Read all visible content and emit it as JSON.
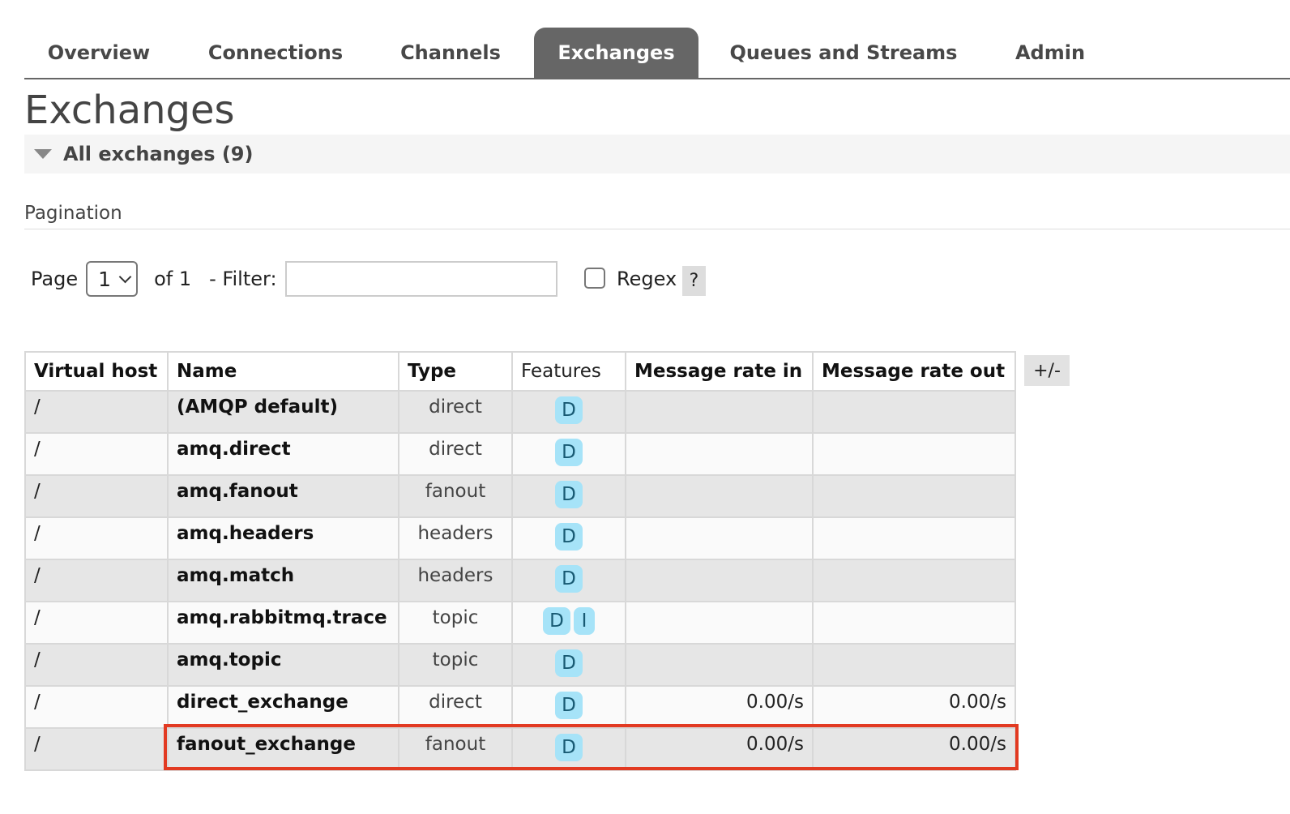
{
  "nav": {
    "tabs": [
      {
        "label": "Overview"
      },
      {
        "label": "Connections"
      },
      {
        "label": "Channels"
      },
      {
        "label": "Exchanges",
        "active": true
      },
      {
        "label": "Queues and Streams"
      },
      {
        "label": "Admin"
      }
    ]
  },
  "page": {
    "title": "Exchanges",
    "section_label": "All exchanges (9)"
  },
  "pagination": {
    "title": "Pagination",
    "page_label": "Page",
    "page_value": "1",
    "of_label": "of 1",
    "filter_label": "- Filter:",
    "filter_value": "",
    "regex_label": "Regex",
    "regex_checked": false,
    "help_label": "?"
  },
  "table": {
    "headers": [
      "Virtual host",
      "Name",
      "Type",
      "Features",
      "Message rate in",
      "Message rate out"
    ],
    "columns_toggle_label": "+/-",
    "rows": [
      {
        "vhost": "/",
        "name": "(AMQP default)",
        "type": "direct",
        "features": [
          "D"
        ],
        "rate_in": "",
        "rate_out": ""
      },
      {
        "vhost": "/",
        "name": "amq.direct",
        "type": "direct",
        "features": [
          "D"
        ],
        "rate_in": "",
        "rate_out": ""
      },
      {
        "vhost": "/",
        "name": "amq.fanout",
        "type": "fanout",
        "features": [
          "D"
        ],
        "rate_in": "",
        "rate_out": ""
      },
      {
        "vhost": "/",
        "name": "amq.headers",
        "type": "headers",
        "features": [
          "D"
        ],
        "rate_in": "",
        "rate_out": ""
      },
      {
        "vhost": "/",
        "name": "amq.match",
        "type": "headers",
        "features": [
          "D"
        ],
        "rate_in": "",
        "rate_out": ""
      },
      {
        "vhost": "/",
        "name": "amq.rabbitmq.trace",
        "type": "topic",
        "features": [
          "D",
          "I"
        ],
        "rate_in": "",
        "rate_out": ""
      },
      {
        "vhost": "/",
        "name": "amq.topic",
        "type": "topic",
        "features": [
          "D"
        ],
        "rate_in": "",
        "rate_out": ""
      },
      {
        "vhost": "/",
        "name": "direct_exchange",
        "type": "direct",
        "features": [
          "D"
        ],
        "rate_in": "0.00/s",
        "rate_out": "0.00/s"
      },
      {
        "vhost": "/",
        "name": "fanout_exchange",
        "type": "fanout",
        "features": [
          "D"
        ],
        "rate_in": "0.00/s",
        "rate_out": "0.00/s",
        "highlighted": true
      }
    ]
  },
  "colors": {
    "active_tab_bg": "#666666",
    "feature_badge_bg": "#a6e3f8",
    "highlight_border": "#e23a22"
  }
}
